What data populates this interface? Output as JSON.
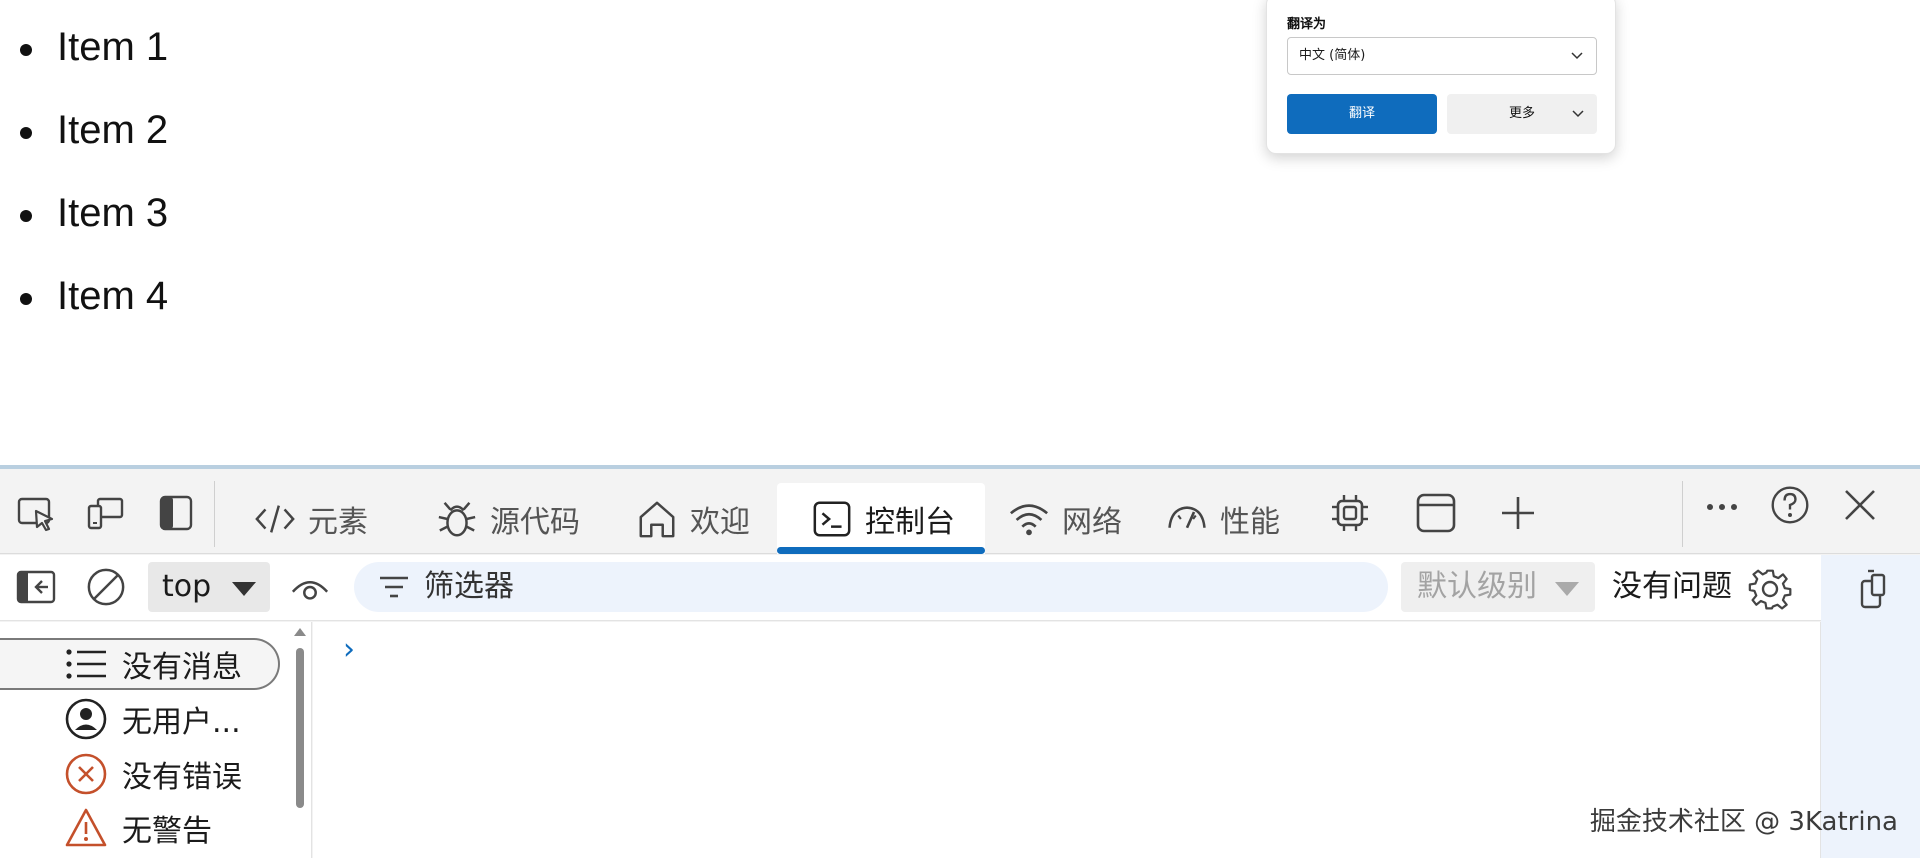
{
  "page": {
    "items": [
      "Item 1",
      "Item 2",
      "Item 3",
      "Item 4"
    ]
  },
  "translate_popup": {
    "label": "翻译为",
    "selected_language": "中文 (简体)",
    "translate_button": "翻译",
    "more_button": "更多"
  },
  "devtools": {
    "tabs": {
      "elements": "元素",
      "sources": "源代码",
      "welcome": "欢迎",
      "console": "控制台",
      "network": "网络",
      "performance": "性能"
    },
    "toolbar": {
      "context": "top",
      "filter_placeholder": "筛选器",
      "level": "默认级别",
      "issues": "没有问题"
    },
    "sidebar": {
      "messages": "没有消息",
      "user_messages": "无用户...",
      "errors": "没有错误",
      "warnings": "无警告"
    },
    "console": {
      "prompt": "›"
    },
    "colors": {
      "accent": "#0f6cbd",
      "error": "#c4502b",
      "warning": "#c4502b"
    }
  },
  "watermark": "掘金技术社区 @ 3Katrina"
}
